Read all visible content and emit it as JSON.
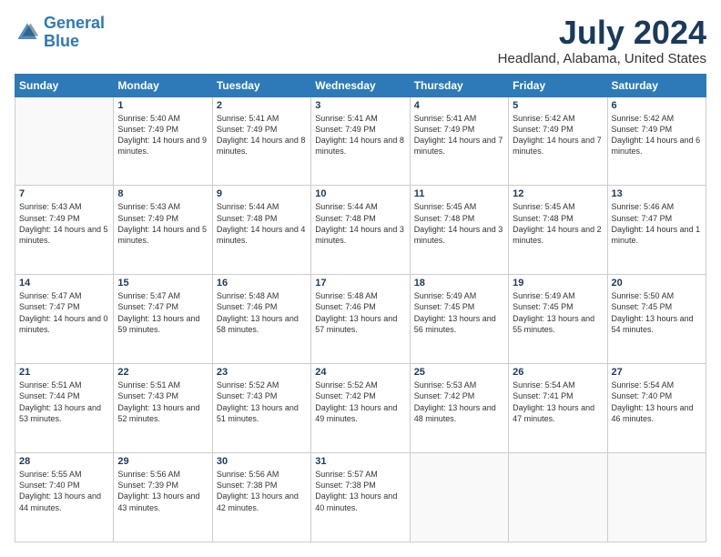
{
  "header": {
    "logo_line1": "General",
    "logo_line2": "Blue",
    "main_title": "July 2024",
    "subtitle": "Headland, Alabama, United States"
  },
  "calendar": {
    "headers": [
      "Sunday",
      "Monday",
      "Tuesday",
      "Wednesday",
      "Thursday",
      "Friday",
      "Saturday"
    ],
    "rows": [
      [
        {
          "day": "",
          "info": ""
        },
        {
          "day": "1",
          "info": "Sunrise: 5:40 AM\nSunset: 7:49 PM\nDaylight: 14 hours\nand 9 minutes."
        },
        {
          "day": "2",
          "info": "Sunrise: 5:41 AM\nSunset: 7:49 PM\nDaylight: 14 hours\nand 8 minutes."
        },
        {
          "day": "3",
          "info": "Sunrise: 5:41 AM\nSunset: 7:49 PM\nDaylight: 14 hours\nand 8 minutes."
        },
        {
          "day": "4",
          "info": "Sunrise: 5:41 AM\nSunset: 7:49 PM\nDaylight: 14 hours\nand 7 minutes."
        },
        {
          "day": "5",
          "info": "Sunrise: 5:42 AM\nSunset: 7:49 PM\nDaylight: 14 hours\nand 7 minutes."
        },
        {
          "day": "6",
          "info": "Sunrise: 5:42 AM\nSunset: 7:49 PM\nDaylight: 14 hours\nand 6 minutes."
        }
      ],
      [
        {
          "day": "7",
          "info": "Sunrise: 5:43 AM\nSunset: 7:49 PM\nDaylight: 14 hours\nand 5 minutes."
        },
        {
          "day": "8",
          "info": "Sunrise: 5:43 AM\nSunset: 7:49 PM\nDaylight: 14 hours\nand 5 minutes."
        },
        {
          "day": "9",
          "info": "Sunrise: 5:44 AM\nSunset: 7:48 PM\nDaylight: 14 hours\nand 4 minutes."
        },
        {
          "day": "10",
          "info": "Sunrise: 5:44 AM\nSunset: 7:48 PM\nDaylight: 14 hours\nand 3 minutes."
        },
        {
          "day": "11",
          "info": "Sunrise: 5:45 AM\nSunset: 7:48 PM\nDaylight: 14 hours\nand 3 minutes."
        },
        {
          "day": "12",
          "info": "Sunrise: 5:45 AM\nSunset: 7:48 PM\nDaylight: 14 hours\nand 2 minutes."
        },
        {
          "day": "13",
          "info": "Sunrise: 5:46 AM\nSunset: 7:47 PM\nDaylight: 14 hours\nand 1 minute."
        }
      ],
      [
        {
          "day": "14",
          "info": "Sunrise: 5:47 AM\nSunset: 7:47 PM\nDaylight: 14 hours\nand 0 minutes."
        },
        {
          "day": "15",
          "info": "Sunrise: 5:47 AM\nSunset: 7:47 PM\nDaylight: 13 hours\nand 59 minutes."
        },
        {
          "day": "16",
          "info": "Sunrise: 5:48 AM\nSunset: 7:46 PM\nDaylight: 13 hours\nand 58 minutes."
        },
        {
          "day": "17",
          "info": "Sunrise: 5:48 AM\nSunset: 7:46 PM\nDaylight: 13 hours\nand 57 minutes."
        },
        {
          "day": "18",
          "info": "Sunrise: 5:49 AM\nSunset: 7:45 PM\nDaylight: 13 hours\nand 56 minutes."
        },
        {
          "day": "19",
          "info": "Sunrise: 5:49 AM\nSunset: 7:45 PM\nDaylight: 13 hours\nand 55 minutes."
        },
        {
          "day": "20",
          "info": "Sunrise: 5:50 AM\nSunset: 7:45 PM\nDaylight: 13 hours\nand 54 minutes."
        }
      ],
      [
        {
          "day": "21",
          "info": "Sunrise: 5:51 AM\nSunset: 7:44 PM\nDaylight: 13 hours\nand 53 minutes."
        },
        {
          "day": "22",
          "info": "Sunrise: 5:51 AM\nSunset: 7:43 PM\nDaylight: 13 hours\nand 52 minutes."
        },
        {
          "day": "23",
          "info": "Sunrise: 5:52 AM\nSunset: 7:43 PM\nDaylight: 13 hours\nand 51 minutes."
        },
        {
          "day": "24",
          "info": "Sunrise: 5:52 AM\nSunset: 7:42 PM\nDaylight: 13 hours\nand 49 minutes."
        },
        {
          "day": "25",
          "info": "Sunrise: 5:53 AM\nSunset: 7:42 PM\nDaylight: 13 hours\nand 48 minutes."
        },
        {
          "day": "26",
          "info": "Sunrise: 5:54 AM\nSunset: 7:41 PM\nDaylight: 13 hours\nand 47 minutes."
        },
        {
          "day": "27",
          "info": "Sunrise: 5:54 AM\nSunset: 7:40 PM\nDaylight: 13 hours\nand 46 minutes."
        }
      ],
      [
        {
          "day": "28",
          "info": "Sunrise: 5:55 AM\nSunset: 7:40 PM\nDaylight: 13 hours\nand 44 minutes."
        },
        {
          "day": "29",
          "info": "Sunrise: 5:56 AM\nSunset: 7:39 PM\nDaylight: 13 hours\nand 43 minutes."
        },
        {
          "day": "30",
          "info": "Sunrise: 5:56 AM\nSunset: 7:38 PM\nDaylight: 13 hours\nand 42 minutes."
        },
        {
          "day": "31",
          "info": "Sunrise: 5:57 AM\nSunset: 7:38 PM\nDaylight: 13 hours\nand 40 minutes."
        },
        {
          "day": "",
          "info": ""
        },
        {
          "day": "",
          "info": ""
        },
        {
          "day": "",
          "info": ""
        }
      ]
    ]
  }
}
